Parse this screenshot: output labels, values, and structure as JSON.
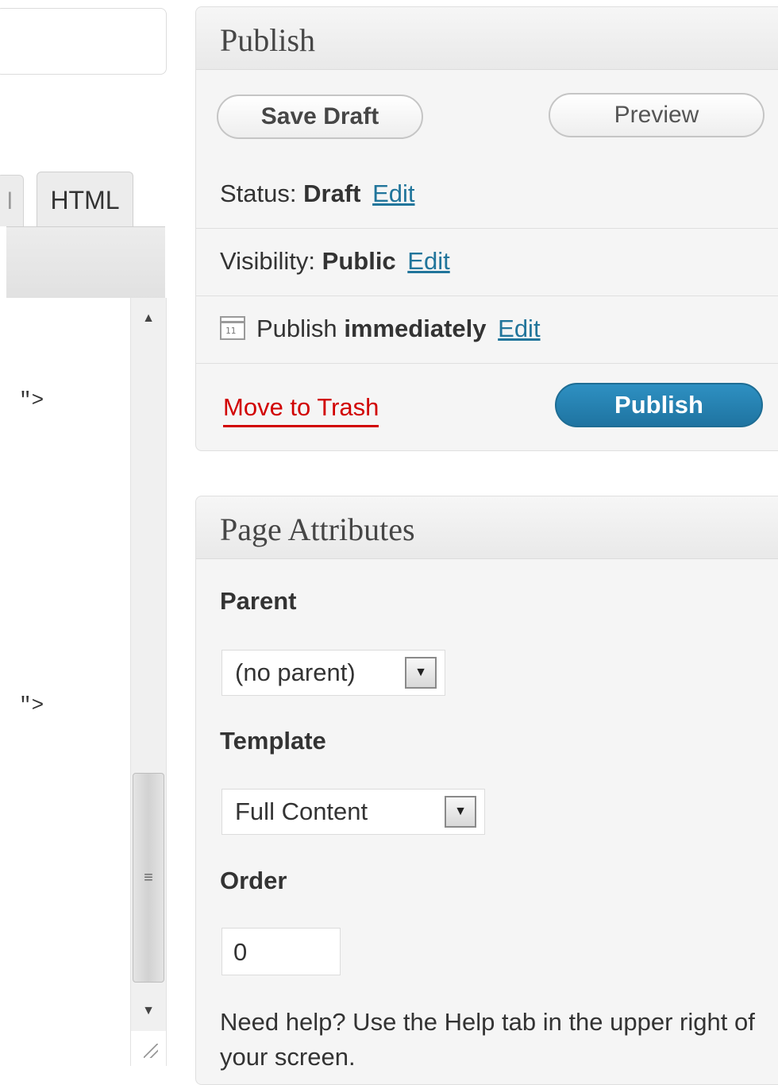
{
  "editor": {
    "tab_partial": "l",
    "tab_html": "HTML",
    "code_line_1": "\">",
    "code_line_2": "\">"
  },
  "publish": {
    "title": "Publish",
    "save_draft": "Save Draft",
    "preview": "Preview",
    "status_label": "Status:",
    "status_value": "Draft",
    "visibility_label": "Visibility:",
    "visibility_value": "Public",
    "schedule_label": "Publish",
    "schedule_value": "immediately",
    "edit_label": "Edit",
    "calendar_icon_day": "11",
    "move_to_trash": "Move to Trash",
    "publish_button": "Publish"
  },
  "page_attributes": {
    "title": "Page Attributes",
    "parent_label": "Parent",
    "parent_value": "(no parent)",
    "template_label": "Template",
    "template_value": "Full Content",
    "order_label": "Order",
    "order_value": "0",
    "help_text": "Need help? Use the Help tab in the upper right of your screen."
  },
  "colors": {
    "link": "#21759b",
    "trash": "#d10000",
    "primary_button": "#2e90c2"
  }
}
